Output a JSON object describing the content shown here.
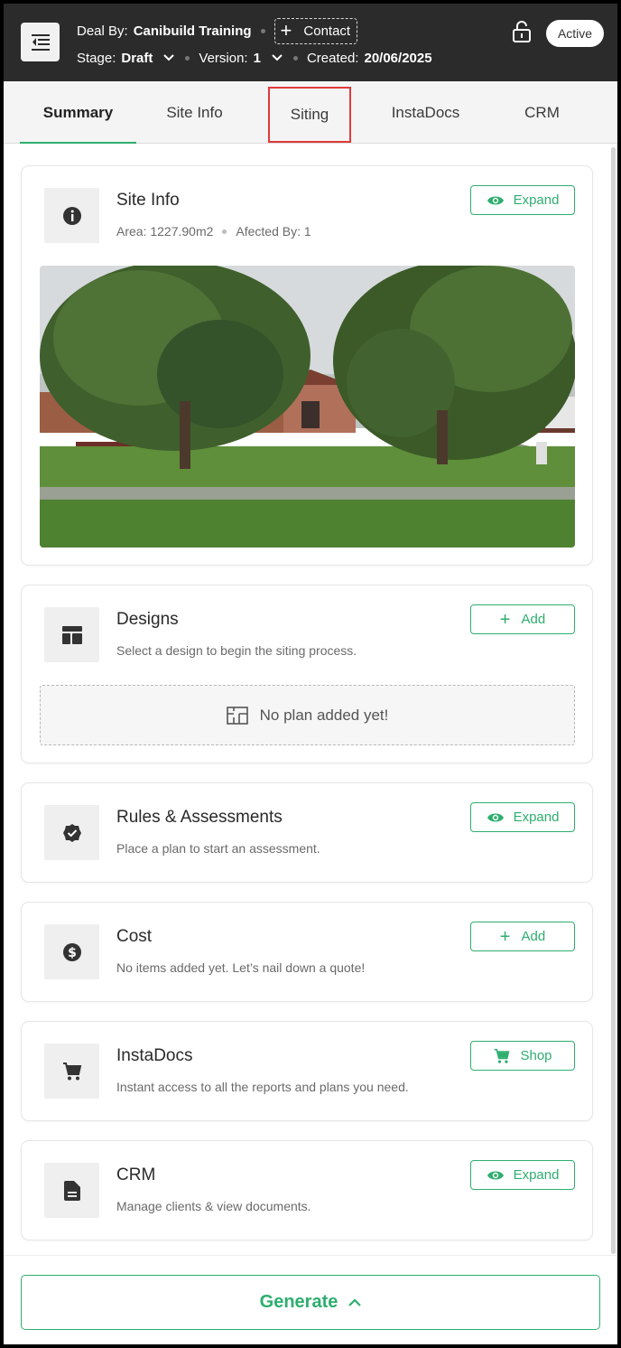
{
  "header": {
    "deal_label": "Deal By:",
    "deal_value": "Canibuild Training",
    "contact_label": "Contact",
    "stage_label": "Stage:",
    "stage_value": "Draft",
    "version_label": "Version:",
    "version_value": "1",
    "created_label": "Created:",
    "created_value": "20/06/2025",
    "status": "Active"
  },
  "tabs": [
    {
      "label": "Summary",
      "active": true
    },
    {
      "label": "Site Info",
      "active": false
    },
    {
      "label": "Siting",
      "active": false
    },
    {
      "label": "InstaDocs",
      "active": false
    },
    {
      "label": "CRM",
      "active": false
    }
  ],
  "site_info": {
    "title": "Site Info",
    "area": "Area: 1227.90m2",
    "affected": "Afected By: 1",
    "button": "Expand"
  },
  "designs": {
    "title": "Designs",
    "subtitle": "Select a design to begin the siting process.",
    "button": "Add",
    "empty": "No plan added yet!"
  },
  "rules": {
    "title": "Rules & Assessments",
    "subtitle": "Place a plan to start an assessment.",
    "button": "Expand"
  },
  "cost": {
    "title": "Cost",
    "subtitle": "No items added yet. Let’s nail down a quote!",
    "button": "Add"
  },
  "instadocs": {
    "title": "InstaDocs",
    "subtitle": "Instant access to all the reports and plans you need.",
    "button": "Shop"
  },
  "crm": {
    "title": "CRM",
    "subtitle": "Manage clients & view documents.",
    "button": "Expand"
  },
  "footer": {
    "generate": "Generate"
  },
  "colors": {
    "accent": "#2eae6f",
    "header_bg": "#2b2b2b",
    "highlight": "#e03a3a"
  }
}
